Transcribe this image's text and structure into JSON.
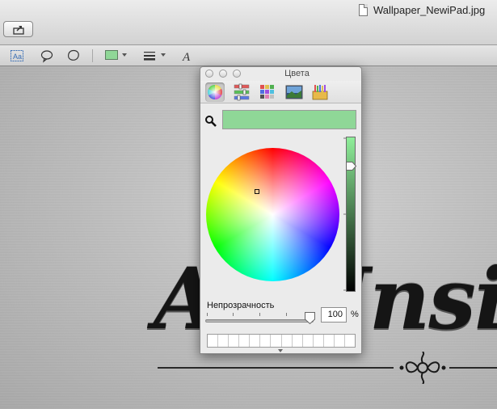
{
  "window": {
    "doc_title": "Wallpaper_NewiPad.jpg"
  },
  "toolbar": {
    "share": "share-button",
    "current_color": "#8fd797"
  },
  "markup_tools": [
    "text-selection-icon",
    "speech-bubble-icon",
    "shape-outline-icon",
    "color-swatch-icon",
    "line-width-icon",
    "font-icon"
  ],
  "canvas": {
    "brand_text": "AppInsi"
  },
  "colors_panel": {
    "title": "Цвета",
    "modes": [
      "color-wheel-mode",
      "sliders-mode",
      "palettes-mode",
      "image-mode",
      "pencils-mode"
    ],
    "selected_mode": "color-wheel-mode",
    "current_color": "#8fd797",
    "opacity_label": "Непрозрачность",
    "opacity_value": "100",
    "opacity_unit": "%",
    "opacity_level": 1.0,
    "swatch_count": 14
  }
}
